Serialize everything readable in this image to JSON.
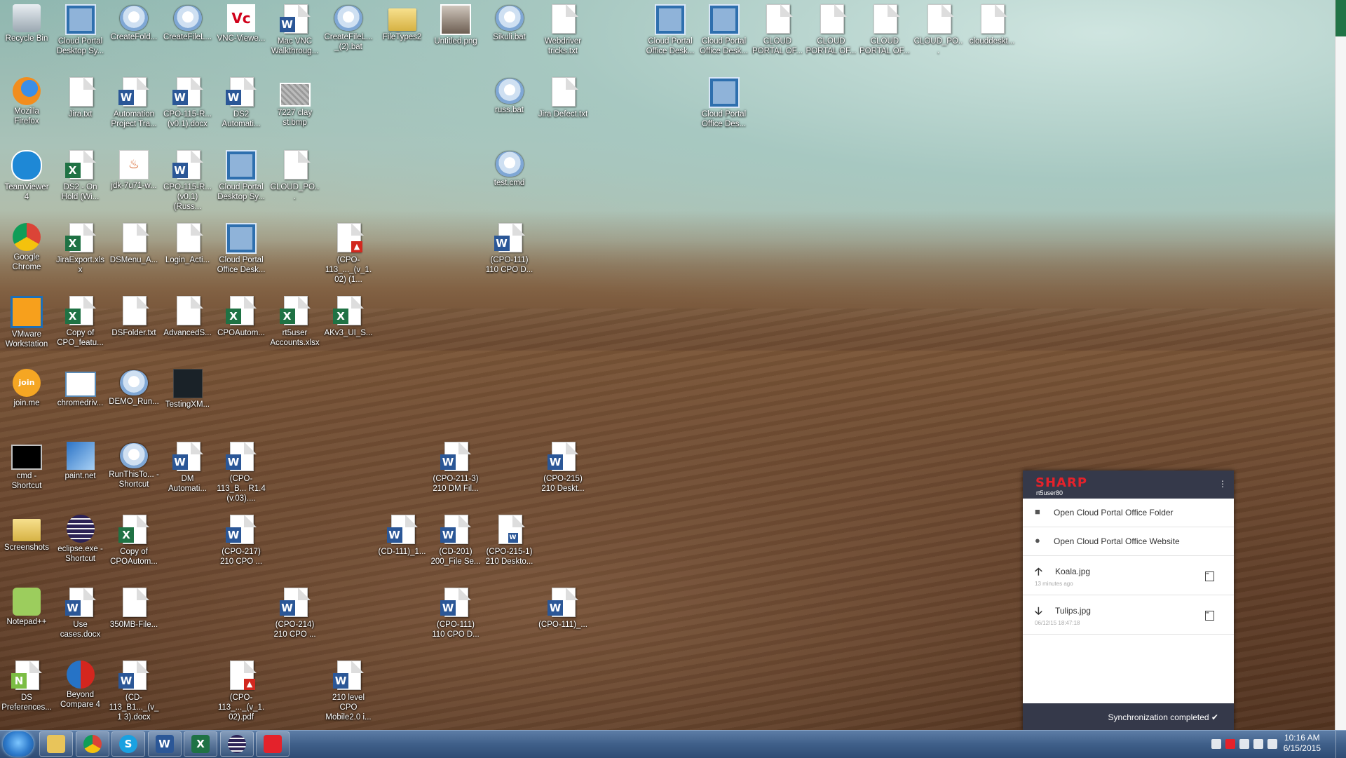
{
  "desktop": {
    "icons": [
      {
        "label": "Recycle Bin",
        "type": "bin"
      },
      {
        "label": "Cloud Portal Desktop Sy...",
        "type": "setup"
      },
      {
        "label": "CreateFold...",
        "type": "bat"
      },
      {
        "label": "CreateFileL...",
        "type": "bat"
      },
      {
        "label": "VNC-Viewe...",
        "type": "vnc"
      },
      {
        "label": "Mac VNC Walkthroug...",
        "type": "word"
      },
      {
        "label": "CreateFileL..._(2).bat",
        "type": "bat"
      },
      {
        "label": "FileTypes2",
        "type": "folder"
      },
      {
        "label": "Untitled.png",
        "type": "photo"
      },
      {
        "label": "Sikuli.bat",
        "type": "bat"
      },
      {
        "label": "Webdriver tricks.txt",
        "type": "doc"
      },
      {
        "label": "Cloud Portal Office Desk...",
        "type": "setup"
      },
      {
        "label": "Cloud Portal Office Desk...",
        "type": "setup"
      },
      {
        "label": "CLOUD PORTAL OF...",
        "type": "doc"
      },
      {
        "label": "CLOUD PORTAL OF...",
        "type": "doc"
      },
      {
        "label": "CLOUD PORTAL OF...",
        "type": "doc"
      },
      {
        "label": "CLOUD_PO...",
        "type": "doc"
      },
      {
        "label": "clouddeskt...",
        "type": "doc"
      },
      {
        "label": "Mozilla Firefox",
        "type": "firefox"
      },
      {
        "label": "Jira.txt",
        "type": "doc"
      },
      {
        "label": "Automation Project Tra...",
        "type": "word"
      },
      {
        "label": "CPO-115-R... (v0.1).docx",
        "type": "word"
      },
      {
        "label": "DS2 Automati...",
        "type": "word"
      },
      {
        "label": "7227 clay st.bmp",
        "type": "image"
      },
      {
        "label": "russ.bat",
        "type": "bat"
      },
      {
        "label": "Jira Defect.txt",
        "type": "doc"
      },
      {
        "label": "Cloud Portal Office Des...",
        "type": "setup"
      },
      {
        "label": "TeamViewer 4",
        "type": "teamviewer"
      },
      {
        "label": "DS2 - On Hold (Wi...",
        "type": "excel"
      },
      {
        "label": "jdk-7u71-w...",
        "type": "java"
      },
      {
        "label": "CPO-115-R... (v0.1) (Russ...",
        "type": "word"
      },
      {
        "label": "Cloud Portal Desktop Sy...",
        "type": "setup"
      },
      {
        "label": "CLOUD_PO...",
        "type": "doc"
      },
      {
        "label": "test.cmd",
        "type": "bat"
      },
      {
        "label": "Google Chrome",
        "type": "chrome"
      },
      {
        "label": "JiraExport.xlsx",
        "type": "excel"
      },
      {
        "label": "DSMenu_A...",
        "type": "doc"
      },
      {
        "label": "Login_Acti...",
        "type": "doc"
      },
      {
        "label": "Cloud Portal Office Desk...",
        "type": "setup"
      },
      {
        "label": "(CPO-113_..._(v_1.02) (1...",
        "type": "pdf"
      },
      {
        "label": "(CPO-111) 110 CPO D...",
        "type": "word"
      },
      {
        "label": "VMware Workstation",
        "type": "vmware"
      },
      {
        "label": "Copy of CPO_featu...",
        "type": "excel"
      },
      {
        "label": "DSFolder.txt",
        "type": "doc"
      },
      {
        "label": "AdvancedS...",
        "type": "doc"
      },
      {
        "label": "CPOAutom...",
        "type": "excel"
      },
      {
        "label": "rt5user Accounts.xlsx",
        "type": "excel"
      },
      {
        "label": "AKv3_UI_S...",
        "type": "excel"
      },
      {
        "label": "join.me",
        "type": "joinme"
      },
      {
        "label": "chromedriv...",
        "type": "window"
      },
      {
        "label": "DEMO_Run...",
        "type": "bat"
      },
      {
        "label": "TestingXM...",
        "type": "dark"
      },
      {
        "label": "cmd - Shortcut",
        "type": "cmd"
      },
      {
        "label": "paint.net",
        "type": "paint"
      },
      {
        "label": "RunThisTo... - Shortcut",
        "type": "bat"
      },
      {
        "label": "DM Automati...",
        "type": "word"
      },
      {
        "label": "(CPO-113_B... R1.4 (v.03)....",
        "type": "word"
      },
      {
        "label": "(CPO-211-3) 210 DM Fil...",
        "type": "word"
      },
      {
        "label": "(CPO-215) 210 Deskt...",
        "type": "word"
      },
      {
        "label": "Screenshots",
        "type": "folder"
      },
      {
        "label": "eclipse.exe - Shortcut",
        "type": "eclipse"
      },
      {
        "label": "Copy of CPOAutom...",
        "type": "excel"
      },
      {
        "label": "(CPO-217) 210 CPO ...",
        "type": "word"
      },
      {
        "label": "(CD-111)_1...",
        "type": "word"
      },
      {
        "label": "(CD-201) 200_File Se...",
        "type": "word"
      },
      {
        "label": "(CPO-215-1) 210 Deskto...",
        "type": "worddoc"
      },
      {
        "label": "Notepad++",
        "type": "notepad"
      },
      {
        "label": "Use cases.docx",
        "type": "word"
      },
      {
        "label": "350MB-File...",
        "type": "doc"
      },
      {
        "label": "(CPO-214) 210 CPO ...",
        "type": "word"
      },
      {
        "label": "(CPO-111) 110 CPO D...",
        "type": "word"
      },
      {
        "label": "(CPO-111)_...",
        "type": "word"
      },
      {
        "label": "DS Preferences...",
        "type": "notepadfile"
      },
      {
        "label": "Beyond Compare 4",
        "type": "beyond"
      },
      {
        "label": "(CD-113_B1..._(v_1 3).docx",
        "type": "word"
      },
      {
        "label": "(CPO-113_..._(v_1.02).pdf",
        "type": "pdf"
      },
      {
        "label": "210 level CPO Mobile2.0 i...",
        "type": "word"
      }
    ]
  },
  "sync_panel": {
    "brand": "SHARP",
    "user": "rt5user80",
    "menu_icon": "menu-icon",
    "actions": [
      {
        "label": "Open Cloud Portal Office Folder",
        "icon": "folder-icon"
      },
      {
        "label": "Open Cloud Portal Office Website",
        "icon": "globe-icon"
      }
    ],
    "files": [
      {
        "name": "Koala.jpg",
        "time": "13 minutes ago",
        "direction": "upload",
        "icon": "upload-arrow-icon"
      },
      {
        "name": "Tulips.jpg",
        "time": "06/12/15 18:47:18",
        "direction": "download",
        "icon": "download-arrow-icon"
      }
    ],
    "status": "Synchronization completed ✔"
  },
  "taskbar": {
    "apps": [
      "Windows Explorer",
      "Google Chrome",
      "Skype",
      "Microsoft Word",
      "Microsoft Excel",
      "Eclipse",
      "Sharp Cloud Portal"
    ],
    "clock_time": "10:16 AM",
    "clock_date": "6/15/2015"
  },
  "colors": {
    "taskbar": "#3f5f89",
    "sync_header": "#35394a",
    "sharp_red": "#e4222b"
  }
}
